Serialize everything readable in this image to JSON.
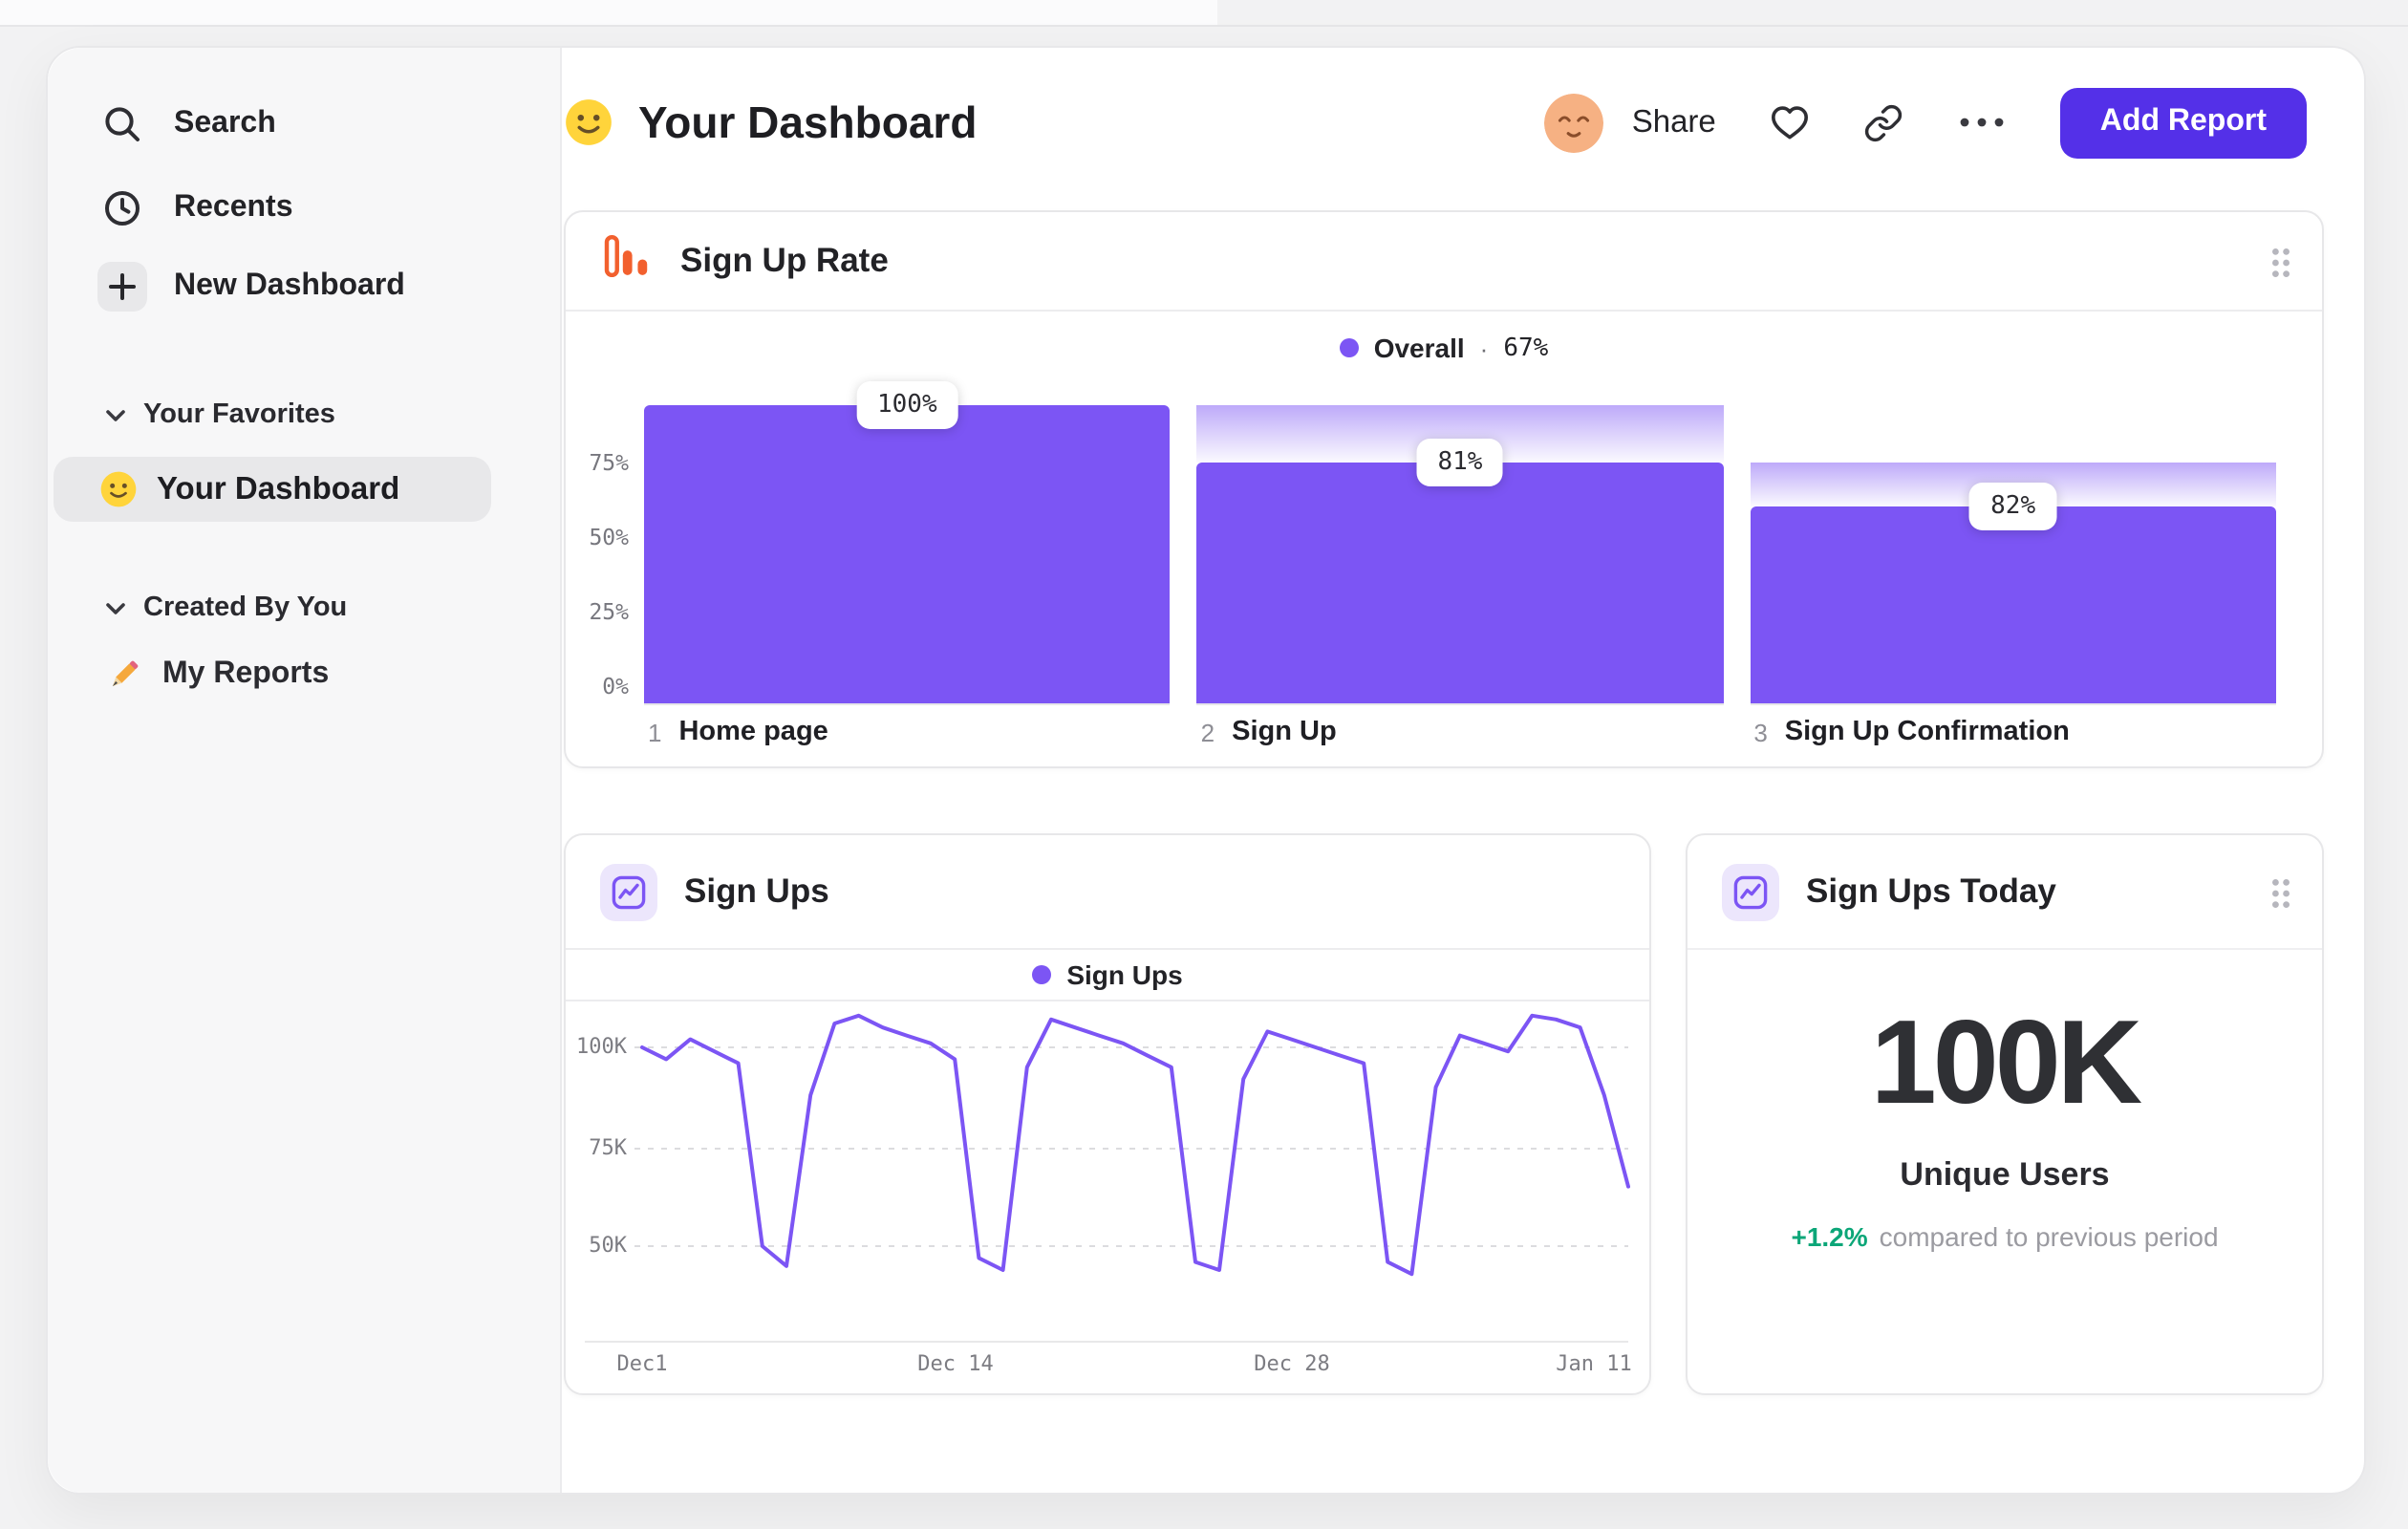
{
  "sidebar": {
    "search": "Search",
    "recents": "Recents",
    "new_dashboard": "New Dashboard",
    "favorites_header": "Your Favorites",
    "favorite_item": "Your Dashboard",
    "created_header": "Created By You",
    "created_item": "My Reports"
  },
  "header": {
    "title": "Your Dashboard",
    "share": "Share",
    "add_report": "Add Report"
  },
  "chart_data": [
    {
      "type": "funnel-bar",
      "title": "Sign Up Rate",
      "legend": {
        "label": "Overall",
        "sep": "·",
        "value": "67%"
      },
      "y_ticks": [
        "75%",
        "50%",
        "25%",
        "0%"
      ],
      "ylim": [
        0,
        100
      ],
      "steps": [
        {
          "num": "1",
          "label": "Home page",
          "conversion_from_previous": "100%",
          "overall_pct": 100,
          "from_overall_pct": 100
        },
        {
          "num": "2",
          "label": "Sign Up",
          "conversion_from_previous": "81%",
          "overall_pct": 81,
          "from_overall_pct": 100
        },
        {
          "num": "3",
          "label": "Sign Up Confirmation",
          "conversion_from_previous": "82%",
          "overall_pct": 66,
          "from_overall_pct": 81
        }
      ]
    },
    {
      "type": "line",
      "title": "Sign Ups",
      "legend": {
        "label": "Sign Ups"
      },
      "y_ticks": [
        "100K",
        "75K",
        "50K"
      ],
      "x_ticks": [
        "Dec1",
        "Dec 14",
        "Dec 28",
        "Jan 11"
      ],
      "grid": "dashed-horizontal",
      "series": [
        {
          "name": "Sign Ups",
          "unit": "K",
          "values": [
            100,
            97,
            102,
            99,
            96,
            50,
            45,
            88,
            106,
            108,
            105,
            103,
            101,
            97,
            47,
            44,
            95,
            107,
            105,
            103,
            101,
            98,
            95,
            46,
            44,
            92,
            104,
            102,
            100,
            98,
            96,
            46,
            43,
            90,
            103,
            101,
            99,
            108,
            107,
            105,
            88,
            65
          ]
        }
      ]
    },
    {
      "type": "number",
      "title": "Sign Ups Today",
      "value": "100K",
      "metric_label": "Unique Users",
      "delta": "+1.2%",
      "delta_caption": "compared to previous period"
    }
  ],
  "colors": {
    "accent": "#7c55f4",
    "button_bg": "#5430e8",
    "icon_orange": "#f2602e",
    "delta_green": "#0ca678"
  }
}
